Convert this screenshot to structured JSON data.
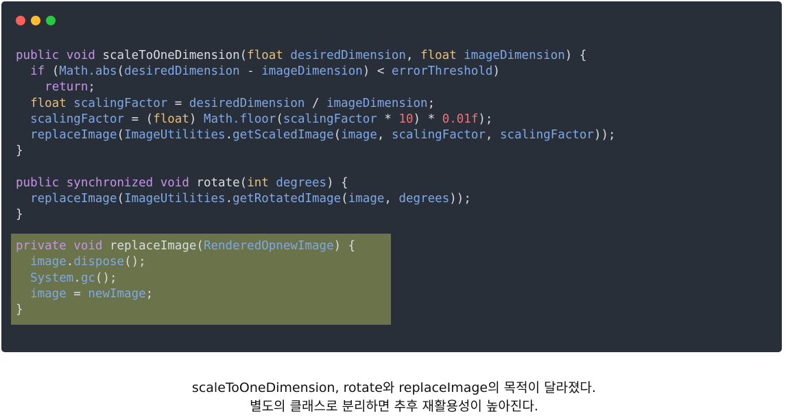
{
  "window": {
    "controls": [
      {
        "name": "close",
        "color": "#ff5f57"
      },
      {
        "name": "minimize",
        "color": "#febc2e"
      },
      {
        "name": "zoom",
        "color": "#28c840"
      }
    ]
  },
  "colors": {
    "editor_background": "#282f38",
    "highlight_background": "#6a734a",
    "keyword": "#c792ea",
    "type": "#e6c07b",
    "identifier": "#7fa8e8",
    "number": "#f07178",
    "plain": "#d9dde3"
  },
  "code": {
    "lines": [
      [
        [
          "kw",
          "public "
        ],
        [
          "kw",
          "void "
        ],
        [
          "pl",
          "scaleToOneDimension("
        ],
        [
          "ty",
          "float "
        ],
        [
          "id",
          "desiredDimension"
        ],
        [
          "pl",
          ", "
        ],
        [
          "ty",
          "float "
        ],
        [
          "id",
          "imageDimension"
        ],
        [
          "pl",
          ") {"
        ]
      ],
      [
        [
          "pl",
          "  "
        ],
        [
          "kw",
          "if "
        ],
        [
          "pl",
          "("
        ],
        [
          "id",
          "Math.abs"
        ],
        [
          "pl",
          "("
        ],
        [
          "id",
          "desiredDimension"
        ],
        [
          "pl",
          " - "
        ],
        [
          "id",
          "imageDimension"
        ],
        [
          "pl",
          ") < "
        ],
        [
          "id",
          "errorThreshold"
        ],
        [
          "pl",
          ")"
        ]
      ],
      [
        [
          "pl",
          "    "
        ],
        [
          "kw",
          "return"
        ],
        [
          "pl",
          ";"
        ]
      ],
      [
        [
          "pl",
          "  "
        ],
        [
          "ty",
          "float "
        ],
        [
          "id",
          "scalingFactor"
        ],
        [
          "pl",
          " = "
        ],
        [
          "id",
          "desiredDimension"
        ],
        [
          "pl",
          " / "
        ],
        [
          "id",
          "imageDimension"
        ],
        [
          "pl",
          ";"
        ]
      ],
      [
        [
          "pl",
          "  "
        ],
        [
          "id",
          "scalingFactor"
        ],
        [
          "pl",
          " = ("
        ],
        [
          "ty",
          "float"
        ],
        [
          "pl",
          ") "
        ],
        [
          "id",
          "Math.floor"
        ],
        [
          "pl",
          "("
        ],
        [
          "id",
          "scalingFactor"
        ],
        [
          "pl",
          " * "
        ],
        [
          "num",
          "10"
        ],
        [
          "pl",
          ") * "
        ],
        [
          "num",
          "0.01f"
        ],
        [
          "pl",
          ");"
        ]
      ],
      [
        [
          "pl",
          "  "
        ],
        [
          "id",
          "replaceImage"
        ],
        [
          "pl",
          "("
        ],
        [
          "id",
          "ImageUtilities"
        ],
        [
          "pl",
          "."
        ],
        [
          "id",
          "getScaledImage"
        ],
        [
          "pl",
          "("
        ],
        [
          "id",
          "image"
        ],
        [
          "pl",
          ", "
        ],
        [
          "id",
          "scalingFactor"
        ],
        [
          "pl",
          ", "
        ],
        [
          "id",
          "scalingFactor"
        ],
        [
          "pl",
          "));"
        ]
      ],
      [
        [
          "pl",
          "}"
        ]
      ],
      [],
      [
        [
          "kw",
          "public "
        ],
        [
          "kw",
          "synchronized "
        ],
        [
          "kw",
          "void "
        ],
        [
          "pl",
          "rotate("
        ],
        [
          "ty",
          "int "
        ],
        [
          "id",
          "degrees"
        ],
        [
          "pl",
          ") {"
        ]
      ],
      [
        [
          "pl",
          "  "
        ],
        [
          "id",
          "replaceImage"
        ],
        [
          "pl",
          "("
        ],
        [
          "id",
          "ImageUtilities"
        ],
        [
          "pl",
          "."
        ],
        [
          "id",
          "getRotatedImage"
        ],
        [
          "pl",
          "("
        ],
        [
          "id",
          "image"
        ],
        [
          "pl",
          ", "
        ],
        [
          "id",
          "degrees"
        ],
        [
          "pl",
          "));"
        ]
      ],
      [
        [
          "pl",
          "}"
        ]
      ],
      [],
      [
        [
          "kw",
          "private "
        ],
        [
          "kw",
          "void "
        ],
        [
          "pl",
          "replaceImage("
        ],
        [
          "id",
          "RenderedOpnewImage"
        ],
        [
          "pl",
          ") {"
        ]
      ],
      [
        [
          "pl",
          "  "
        ],
        [
          "id",
          "image"
        ],
        [
          "pl",
          "."
        ],
        [
          "id",
          "dispose"
        ],
        [
          "pl",
          "();"
        ]
      ],
      [
        [
          "pl",
          "  "
        ],
        [
          "id",
          "System"
        ],
        [
          "pl",
          "."
        ],
        [
          "id",
          "gc"
        ],
        [
          "pl",
          "();"
        ]
      ],
      [
        [
          "pl",
          "  "
        ],
        [
          "id",
          "image"
        ],
        [
          "pl",
          " = "
        ],
        [
          "id",
          "newImage"
        ],
        [
          "pl",
          ";"
        ]
      ],
      [
        [
          "pl",
          "}"
        ]
      ]
    ]
  },
  "caption": {
    "line1": "scaleToOneDimension, rotate와 replaceImage의 목적이 달라졌다.",
    "line2": "별도의 클래스로 분리하면 추후 재활용성이 높아진다."
  }
}
